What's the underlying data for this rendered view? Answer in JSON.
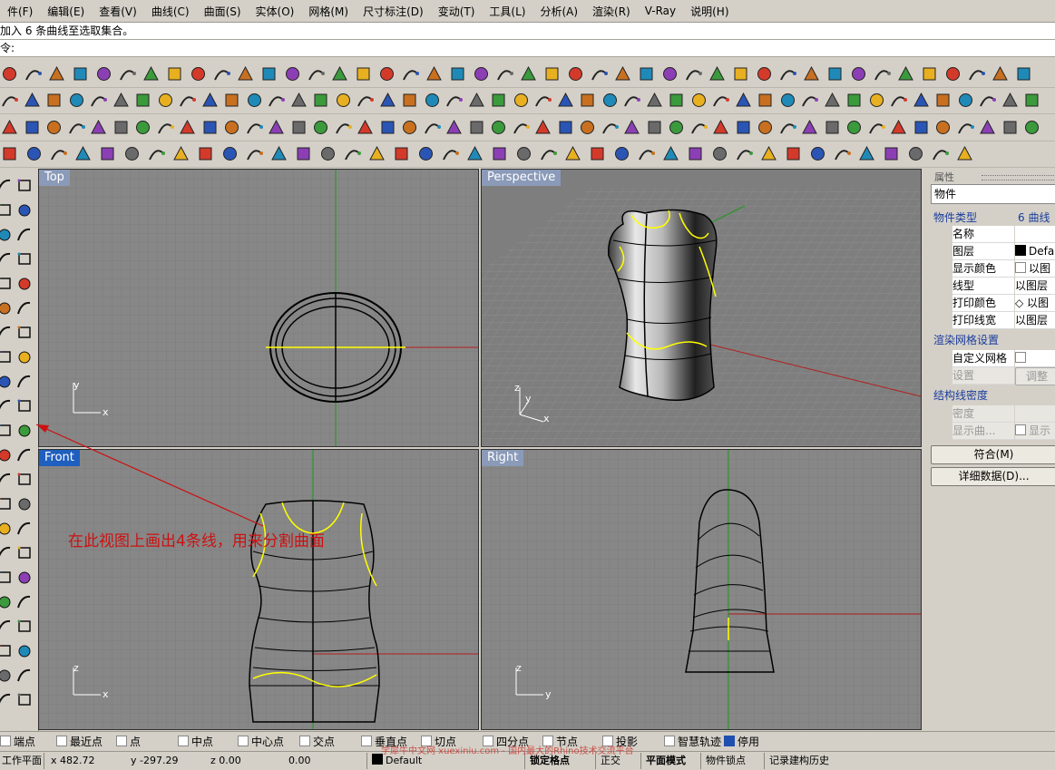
{
  "menu": [
    "件(F)",
    "编辑(E)",
    "查看(V)",
    "曲线(C)",
    "曲面(S)",
    "实体(O)",
    "网格(M)",
    "尺寸标注(D)",
    "变动(T)",
    "工具(L)",
    "分析(A)",
    "渲染(R)",
    "V-Ray",
    "说明(H)"
  ],
  "command": {
    "history": "加入 6 条曲线至选取集合。",
    "prompt": "令:"
  },
  "viewports": {
    "top": "Top",
    "perspective": "Perspective",
    "front": "Front",
    "right": "Right"
  },
  "annotation": "在此视图上画出4条线，用来分割曲面",
  "properties": {
    "panel_title": "属性",
    "dropdown": "物件",
    "type_label": "物件类型",
    "type_value": "6 曲线",
    "rows": [
      {
        "key": "名称",
        "value": ""
      },
      {
        "key": "图层",
        "value": "Defa"
      },
      {
        "key": "显示颜色",
        "value": "以图"
      },
      {
        "key": "线型",
        "value": "以图层"
      },
      {
        "key": "打印颜色",
        "value": "以图"
      },
      {
        "key": "打印线宽",
        "value": "以图层"
      }
    ],
    "render_mesh_section": "渲染网格设置",
    "custom_mesh": "自定义网格",
    "settings": "设置",
    "adjust": "调整",
    "isocurve_section": "结构线密度",
    "density": "密度",
    "display_curves": "显示曲...",
    "display": "显示",
    "match_button": "符合(M)",
    "details_button": "详细数据(D)..."
  },
  "osnap": [
    "端点",
    "最近点",
    "点",
    "中点",
    "中心点",
    "交点",
    "垂直点",
    "切点",
    "四分点",
    "节点",
    "投影",
    "智慧轨迹",
    "停用"
  ],
  "osnap_checked": [
    true,
    false,
    false,
    true,
    true,
    false,
    false,
    false,
    true,
    false,
    false,
    false,
    true
  ],
  "status": {
    "cplane": "工作平面",
    "x": "x 482.72",
    "y": "y -297.29",
    "z": "z 0.00",
    "d": "0.00",
    "layer": "Default",
    "grid_snap": "锁定格点",
    "ortho": "正交",
    "planar": "平面模式",
    "osnap": "物件锁点",
    "history": "记录建构历史"
  },
  "watermark": "学犀牛中文网 xuexiniu.com - 国内最大的Rhino技术交流平台",
  "axes": {
    "x": "x",
    "y": "y",
    "z": "z"
  },
  "colors": {
    "viewport_bg": "#878787",
    "active_label": "#1f5fbf",
    "inactive_label": "#8a9ab8",
    "selected_curve": "#ffff00",
    "x_axis": "#b41e1e",
    "y_axis": "#1c9a1c",
    "annotation": "#cc1111"
  }
}
